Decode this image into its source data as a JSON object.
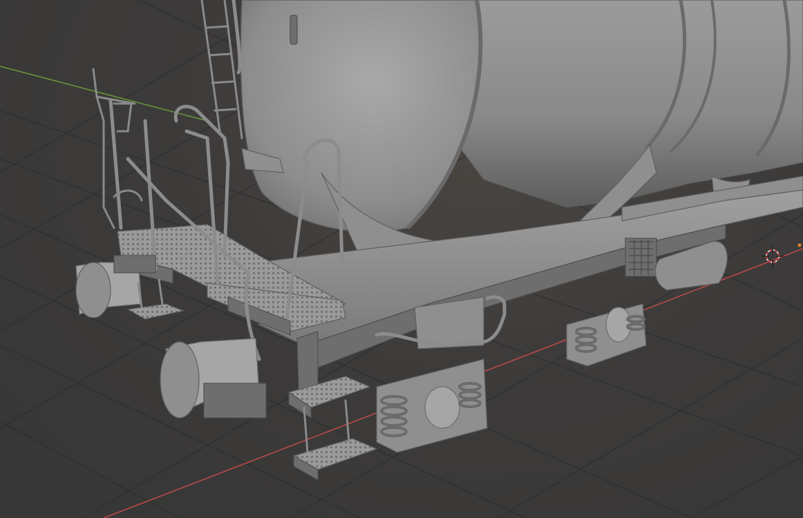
{
  "viewport": {
    "mode": "3d-viewport",
    "shading": "solid",
    "object": "tank-wagon-model",
    "axes": {
      "x_axis_color": "#c04a4a",
      "y_axis_color": "#6a9a3a"
    },
    "background_color": "#3d3b3a",
    "grid_color": "#2c2c2c",
    "model_color": "#8f8f8f",
    "cursor_icon": "3d-cursor-icon"
  }
}
